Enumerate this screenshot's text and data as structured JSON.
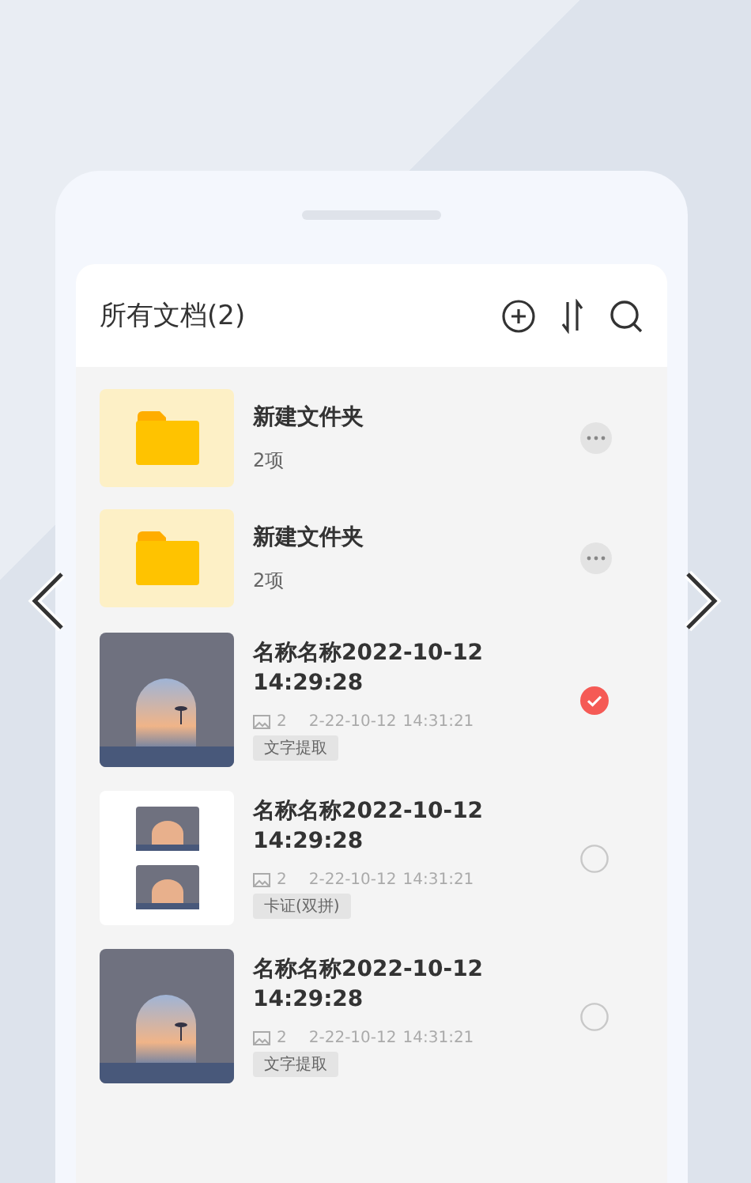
{
  "header": {
    "title": "所有文档(2)"
  },
  "items": [
    {
      "kind": "folder",
      "name": "新建文件夹",
      "count": "2项"
    },
    {
      "kind": "folder",
      "name": "新建文件夹",
      "count": "2项"
    },
    {
      "kind": "doc",
      "name": "名称名称2022-10-12 14:29:28",
      "pages": "2",
      "date": "2-22-10-12",
      "time": "14:31:21",
      "tag": "文字提取",
      "selected": true
    },
    {
      "kind": "doc",
      "name": "名称名称2022-10-12 14:29:28",
      "pages": "2",
      "date": "2-22-10-12",
      "time": "14:31:21",
      "tag": "卡证(双拼)",
      "selected": false
    },
    {
      "kind": "doc",
      "name": "名称名称2022-10-12 14:29:28",
      "pages": "2",
      "date": "2-22-10-12",
      "time": "14:31:21",
      "tag": "文字提取",
      "selected": false
    }
  ]
}
